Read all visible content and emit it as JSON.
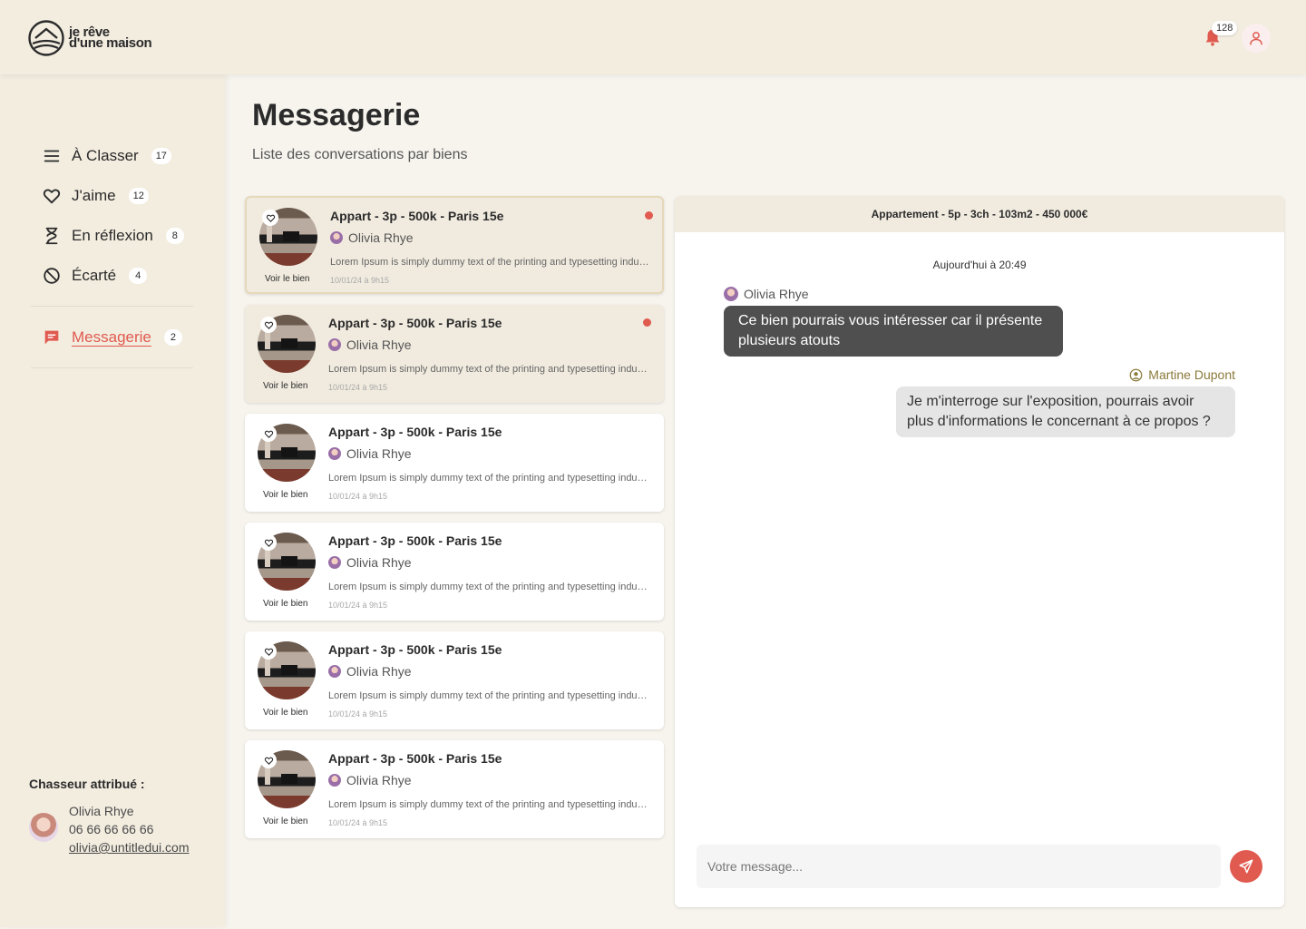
{
  "brand": {
    "line1": "je rêve",
    "line2": "d'une maison"
  },
  "header": {
    "notification_count": "128"
  },
  "sidebar": {
    "items": [
      {
        "label": "À Classer",
        "count": "17"
      },
      {
        "label": "J'aime",
        "count": "12"
      },
      {
        "label": "En réflexion",
        "count": "8"
      },
      {
        "label": "Écarté",
        "count": "4"
      }
    ],
    "messagerie": {
      "label": "Messagerie",
      "count": "2"
    },
    "chasseur": {
      "title": "Chasseur attribué :",
      "name": "Olivia Rhye",
      "phone": "06 66 66 66 66",
      "email": "olivia@untitledui.com"
    }
  },
  "main": {
    "title": "Messagerie",
    "subtitle": "Liste des conversations par biens"
  },
  "conversations": [
    {
      "title": "Appart - 3p - 500k - Paris 15e",
      "user": "Olivia Rhye",
      "preview": "Lorem Ipsum is simply dummy text of the printing and typesetting industry.",
      "date": "10/01/24 à 9h15",
      "voir": "Voir le bien"
    },
    {
      "title": "Appart - 3p - 500k - Paris 15e",
      "user": "Olivia Rhye",
      "preview": "Lorem Ipsum is simply dummy text of the printing and typesetting industry.",
      "date": "10/01/24 à 9h15",
      "voir": "Voir le bien"
    },
    {
      "title": "Appart - 3p - 500k - Paris 15e",
      "user": "Olivia Rhye",
      "preview": "Lorem Ipsum is simply dummy text of the printing and typesetting industry.",
      "date": "10/01/24 à 9h15",
      "voir": "Voir le bien"
    },
    {
      "title": "Appart - 3p - 500k - Paris 15e",
      "user": "Olivia Rhye",
      "preview": "Lorem Ipsum is simply dummy text of the printing and typesetting industry.",
      "date": "10/01/24 à 9h15",
      "voir": "Voir le bien"
    },
    {
      "title": "Appart - 3p - 500k - Paris 15e",
      "user": "Olivia Rhye",
      "preview": "Lorem Ipsum is simply dummy text of the printing and typesetting industry.",
      "date": "10/01/24 à 9h15",
      "voir": "Voir le bien"
    },
    {
      "title": "Appart - 3p - 500k - Paris 15e",
      "user": "Olivia Rhye",
      "preview": "Lorem Ipsum is simply dummy text of the printing and typesetting industry.",
      "date": "10/01/24 à 9h15",
      "voir": "Voir le bien"
    }
  ],
  "chat": {
    "header": "Appartement - 5p - 3ch - 103m2 - 450 000€",
    "time": "Aujourd'hui à 20:49",
    "messages": [
      {
        "sender": "Olivia Rhye",
        "text": "Ce bien pourrais vous intéresser car il présente plusieurs atouts"
      },
      {
        "sender": "Martine Dupont",
        "text": "Je m'interroge sur l'exposition, pourrais avoir plus d'informations le concernant à ce propos ?"
      }
    ],
    "input_placeholder": "Votre message..."
  },
  "colors": {
    "accent": "#e05a4f",
    "beige": "#f3ede0",
    "unread": "#f1ebdf",
    "bubble_dark": "#4f4f4f"
  },
  "icons": [
    "bell-icon",
    "user-icon",
    "menu-icon",
    "heart-icon",
    "hourglass-icon",
    "ban-icon",
    "message-icon",
    "send-icon"
  ]
}
